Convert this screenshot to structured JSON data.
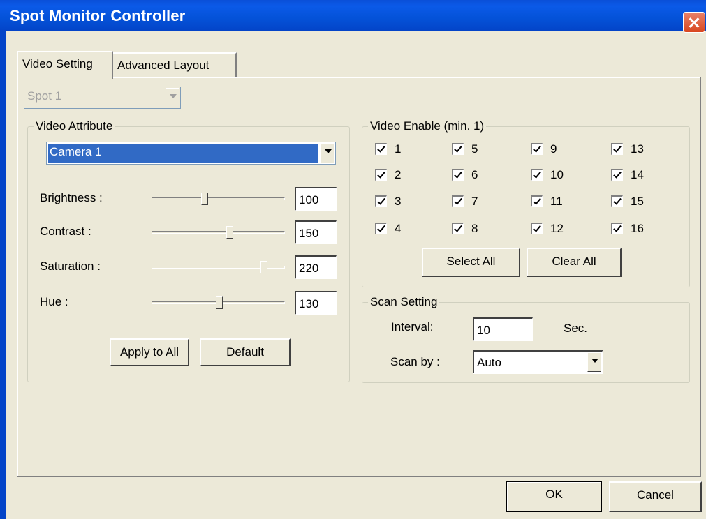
{
  "window": {
    "title": "Spot Monitor Controller"
  },
  "tabs": [
    {
      "label": "Video Setting"
    },
    {
      "label": "Advanced Layout"
    }
  ],
  "spot_select": {
    "value": "Spot 1"
  },
  "video_attribute": {
    "legend": "Video Attribute",
    "camera": "Camera 1",
    "sliders": [
      {
        "label": "Brightness :",
        "value": "100",
        "level": 0.39
      },
      {
        "label": "Contrast :",
        "value": "150",
        "level": 0.59
      },
      {
        "label": "Saturation :",
        "value": "220",
        "level": 0.86
      },
      {
        "label": "Hue :",
        "value": "130",
        "level": 0.51
      }
    ],
    "apply_label": "Apply to All",
    "default_label": "Default"
  },
  "video_enable": {
    "legend": "Video Enable (min. 1)",
    "channels": [
      "1",
      "2",
      "3",
      "4",
      "5",
      "6",
      "7",
      "8",
      "9",
      "10",
      "11",
      "12",
      "13",
      "14",
      "15",
      "16"
    ],
    "select_all_label": "Select All",
    "clear_all_label": "Clear All"
  },
  "scan_setting": {
    "legend": "Scan Setting",
    "interval_label": "Interval:",
    "interval_value": "10",
    "unit": "Sec.",
    "scan_by_label": "Scan by :",
    "scan_by_value": "Auto"
  },
  "footer": {
    "ok_label": "OK",
    "cancel_label": "Cancel"
  }
}
